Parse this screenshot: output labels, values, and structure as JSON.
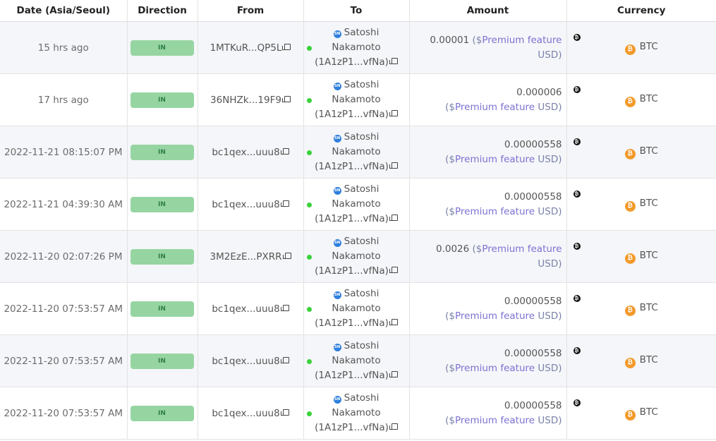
{
  "columns": {
    "date": "Date (Asia/Seoul)",
    "direction": "Direction",
    "from": "From",
    "to": "To",
    "amount": "Amount",
    "currency": "Currency"
  },
  "recipient": {
    "name_line1": "Satoshi",
    "name_line2": "Nakamoto",
    "address": "(1A1zP1...vfNa)",
    "entity_badge": "SN"
  },
  "price": {
    "open": "($",
    "premium": "Premium feature",
    "close": " USD)"
  },
  "icons": {
    "currency_coin": "₿",
    "entity_mark": "₿"
  },
  "colors": {
    "direction_pill_bg": "#96d5a2",
    "premium_text": "#7a71d2",
    "status_dot": "#3ad23a",
    "btc_orange": "#f39a2b"
  },
  "rows": [
    {
      "date": "15 hrs ago",
      "direction": "IN",
      "from": "1MTKuR...QP5L",
      "amount": "0.00001",
      "currency": "BTC"
    },
    {
      "date": "17 hrs ago",
      "direction": "IN",
      "from": "36NHZk...19F9",
      "amount": "0.000006",
      "currency": "BTC"
    },
    {
      "date": "2022-11-21 08:15:07 PM",
      "direction": "IN",
      "from": "bc1qex...uuu8",
      "amount": "0.00000558",
      "currency": "BTC"
    },
    {
      "date": "2022-11-21 04:39:30 AM",
      "direction": "IN",
      "from": "bc1qex...uuu8",
      "amount": "0.00000558",
      "currency": "BTC"
    },
    {
      "date": "2022-11-20 02:07:26 PM",
      "direction": "IN",
      "from": "3M2EzE...PXRR",
      "amount": "0.0026",
      "currency": "BTC"
    },
    {
      "date": "2022-11-20 07:53:57 AM",
      "direction": "IN",
      "from": "bc1qex...uuu8",
      "amount": "0.00000558",
      "currency": "BTC"
    },
    {
      "date": "2022-11-20 07:53:57 AM",
      "direction": "IN",
      "from": "bc1qex...uuu8",
      "amount": "0.00000558",
      "currency": "BTC"
    },
    {
      "date": "2022-11-20 07:53:57 AM",
      "direction": "IN",
      "from": "bc1qex...uuu8",
      "amount": "0.00000558",
      "currency": "BTC"
    }
  ]
}
